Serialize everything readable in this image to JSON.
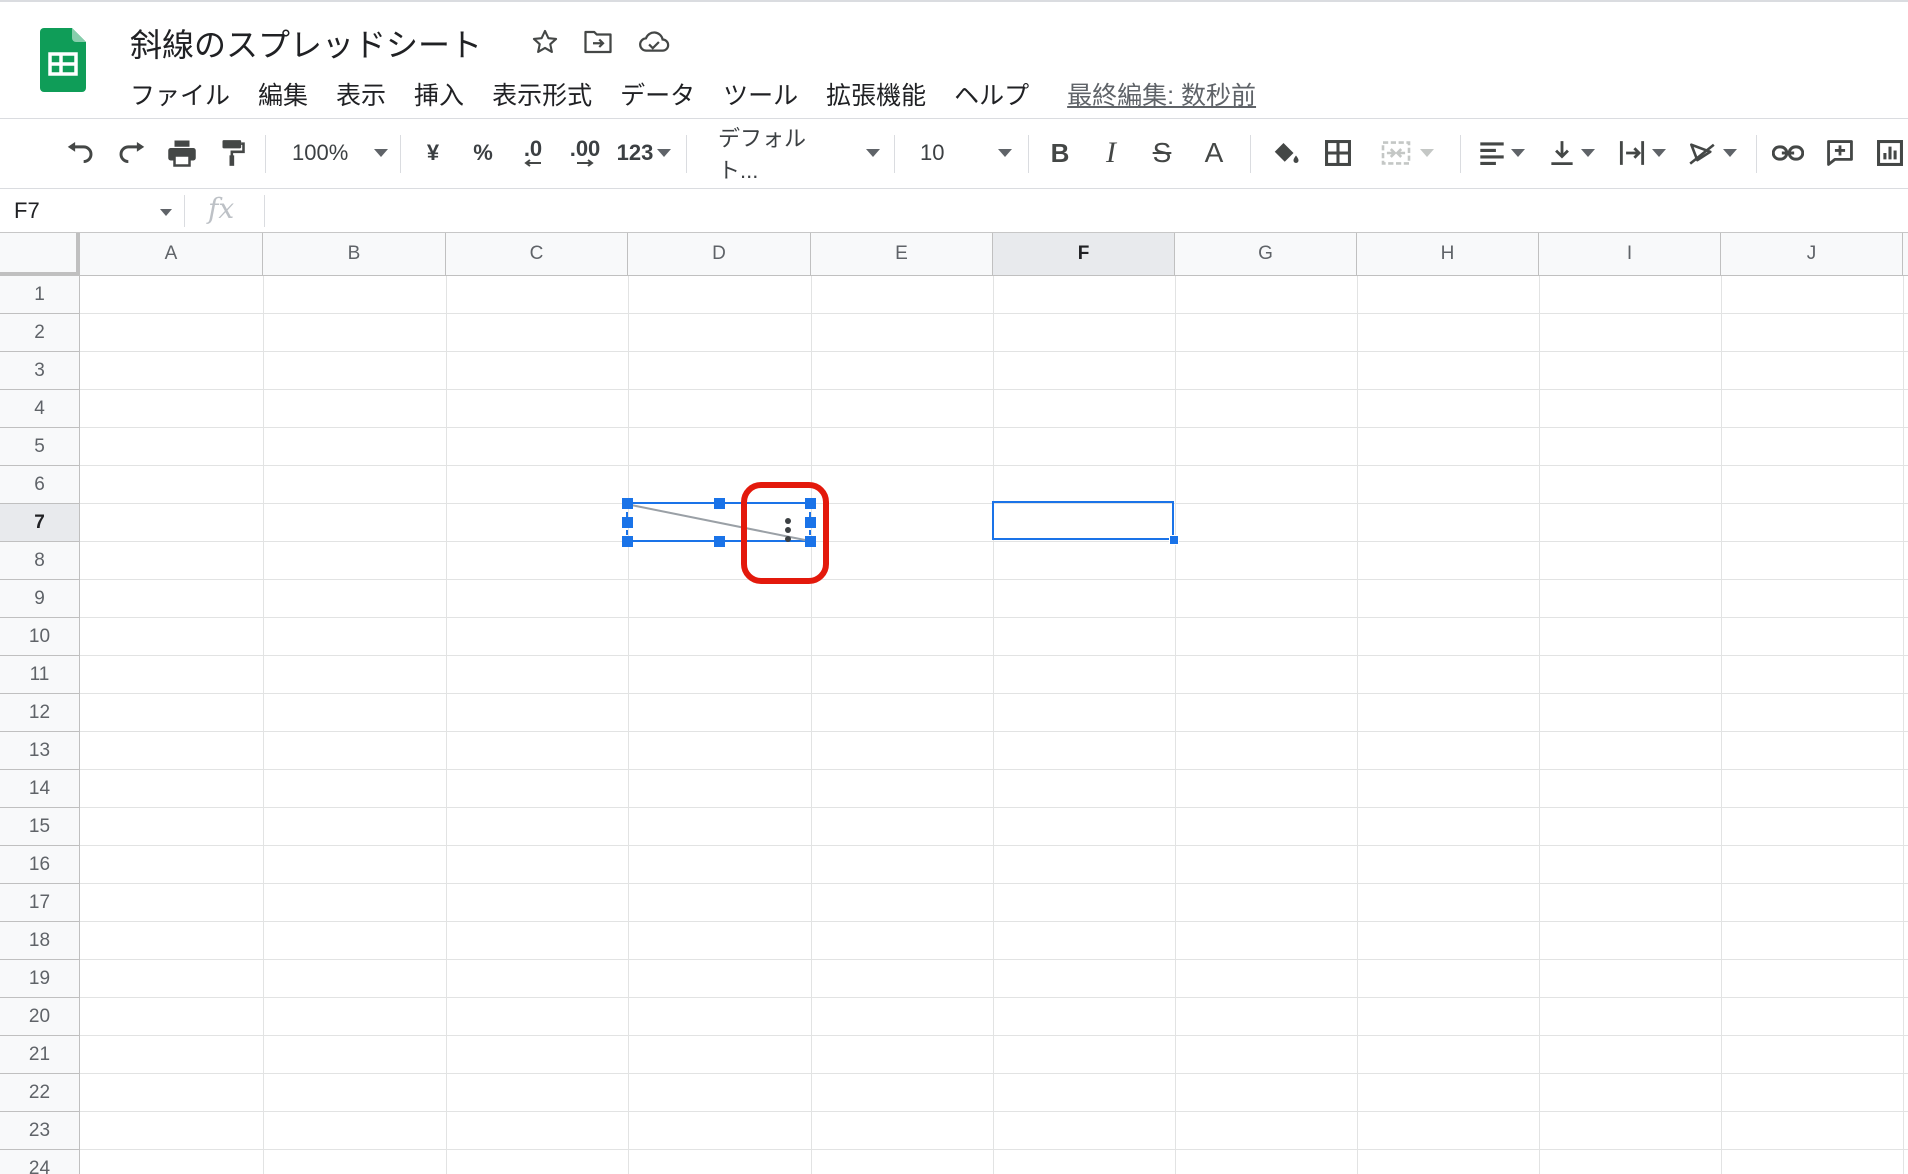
{
  "document": {
    "title": "斜線のスプレッドシート"
  },
  "menu": {
    "items": [
      "ファイル",
      "編集",
      "表示",
      "挿入",
      "表示形式",
      "データ",
      "ツール",
      "拡張機能",
      "ヘルプ"
    ],
    "last_edit": "最終編集: 数秒前"
  },
  "toolbar": {
    "zoom": "100%",
    "currency": "¥",
    "percent": "%",
    "decrease_decimal": ".0",
    "increase_decimal": ".00",
    "number_format": "123",
    "font": "デフォルト...",
    "font_size": "10",
    "bold": "B",
    "italic": "I",
    "strikethrough": "S",
    "text_color": "A"
  },
  "formula_bar": {
    "cell_ref": "F7",
    "fx": "fx",
    "value": ""
  },
  "grid": {
    "columns": [
      "A",
      "B",
      "C",
      "D",
      "E",
      "F",
      "G",
      "H",
      "I",
      "J"
    ],
    "rows": [
      "1",
      "2",
      "3",
      "4",
      "5",
      "6",
      "7",
      "8",
      "9",
      "10",
      "11",
      "12",
      "13",
      "14",
      "15",
      "16",
      "17",
      "18",
      "19",
      "20",
      "21",
      "22",
      "23",
      "24"
    ],
    "active_column": "F",
    "active_row": "7",
    "selected_cell": "F7"
  },
  "colors": {
    "accent": "#1a73e8",
    "highlight": "#e3190c",
    "sheets_green": "#0f9d58"
  },
  "icons": {
    "app": "google-sheets-icon",
    "star": "star-icon",
    "move": "move-to-folder-icon",
    "cloud": "cloud-saved-icon",
    "drawing_menu": "more-vert-icon"
  }
}
